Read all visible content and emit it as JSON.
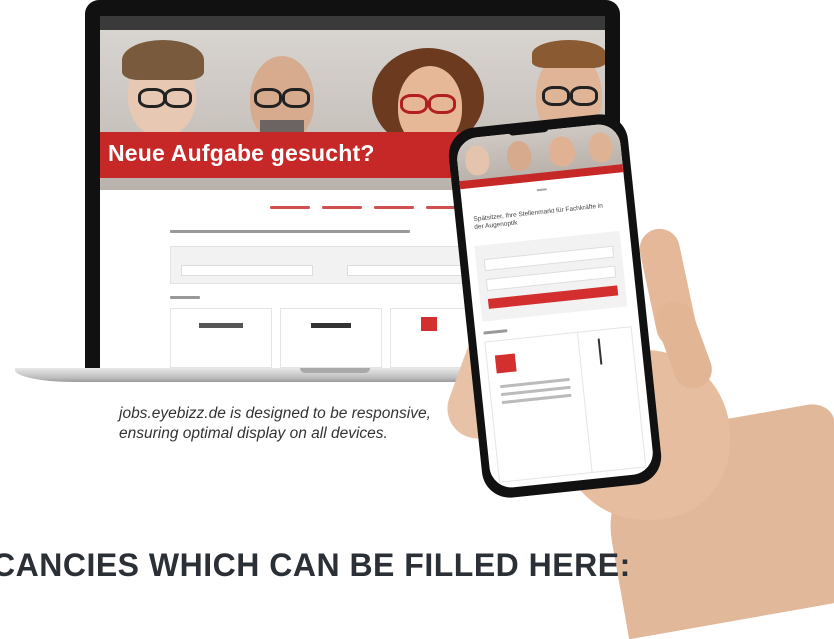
{
  "laptop": {
    "hero_title": "Neue Aufgabe gesucht?"
  },
  "phone": {
    "title": "Spätsitzer, Ihre Stellenmarkt für Fachkräfte in der Augenoptik"
  },
  "caption": "jobs.eyebizz.de is designed to be responsive, ensuring optimal display on all devices.",
  "heading": "CANCIES WHICH CAN BE FILLED HERE:",
  "colors": {
    "brand_red": "#c62828",
    "heading": "#2b2f36"
  }
}
